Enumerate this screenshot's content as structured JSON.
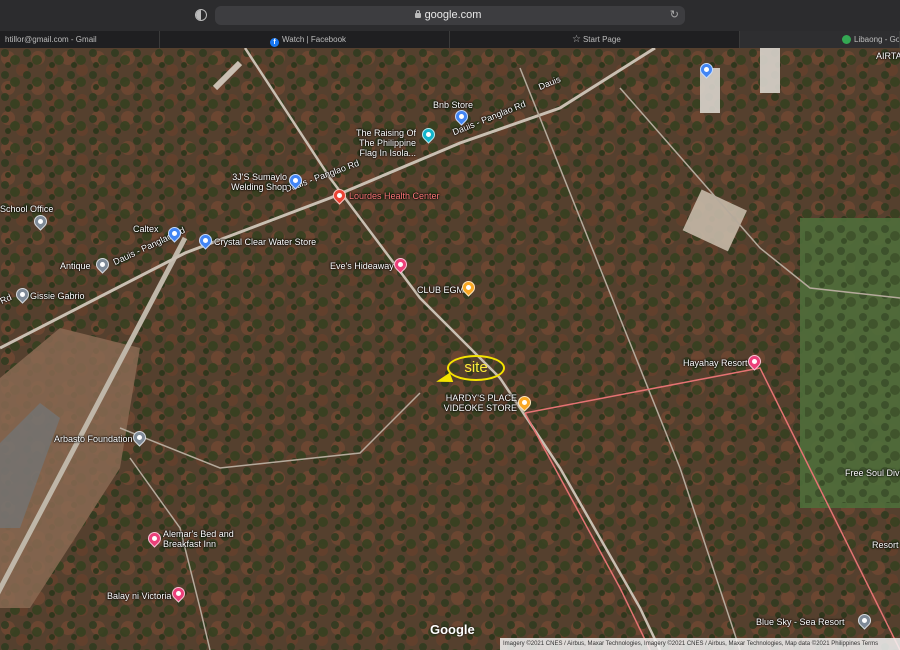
{
  "browser": {
    "url": "google.com",
    "tabs": [
      {
        "label": "htillor@gmail.com - Gmail"
      },
      {
        "label": "Watch | Facebook"
      },
      {
        "label": "Start Page"
      },
      {
        "label": "Libaong - Goog"
      }
    ]
  },
  "map": {
    "site_label": "site",
    "google_logo": "Google",
    "attribution": "Imagery ©2021 CNES / Airbus, Maxar Technologies, Imagery ©2021 CNES / Airbus, Maxar Technologies, Map data ©2021   Philippines   Terms",
    "roads": [
      {
        "name": "Dauis - Panglao Rd"
      },
      {
        "name": "Dauis - Panglao Rd"
      },
      {
        "name": "Dauis - Panglao Rd"
      },
      {
        "name": "Dauis - Panglao Rd"
      },
      {
        "name": "Dauis"
      }
    ],
    "places": [
      {
        "name": "Bnb Store",
        "color": "#4285f4"
      },
      {
        "name": "The Raising Of The Philippine Flag In Isola...",
        "color": "#12b5cb"
      },
      {
        "name": "3J'S Sumaylo Welding Shop",
        "color": "#4285f4"
      },
      {
        "name": "Lourdes Health Center",
        "color": "#ea4335"
      },
      {
        "name": "School Office",
        "color": "#7e8a97"
      },
      {
        "name": "Caltex",
        "color": "#4285f4"
      },
      {
        "name": "Crystal Clear Water Store",
        "color": "#4285f4"
      },
      {
        "name": "Antique",
        "color": "#7e8a97"
      },
      {
        "name": "Eve's Hideaway",
        "color": "#ec407a"
      },
      {
        "name": "CLUB EGM",
        "color": "#f9a825"
      },
      {
        "name": "Gissie Gabrio",
        "color": "#7e8a97"
      },
      {
        "name": "HARDY'S PLACE VIDEOKE STORE",
        "color": "#f9a825"
      },
      {
        "name": "Hayahay Resort",
        "color": "#ec407a"
      },
      {
        "name": "Arbasto Foundation",
        "color": "#7e8a97"
      },
      {
        "name": "Alemar's Bed and Breakfast Inn",
        "color": "#ec407a"
      },
      {
        "name": "Balay ni Victoria",
        "color": "#ec407a"
      },
      {
        "name": "Blue Sky - Sea Resort",
        "color": "#7e8a97"
      },
      {
        "name": "Free Soul Divi",
        "color": "#ffffff"
      },
      {
        "name": "Resort",
        "color": "#ffffff"
      },
      {
        "name": "AIRTA",
        "color": "#ffffff"
      },
      {
        "name": "Rd",
        "color": "#ffffff"
      }
    ]
  }
}
